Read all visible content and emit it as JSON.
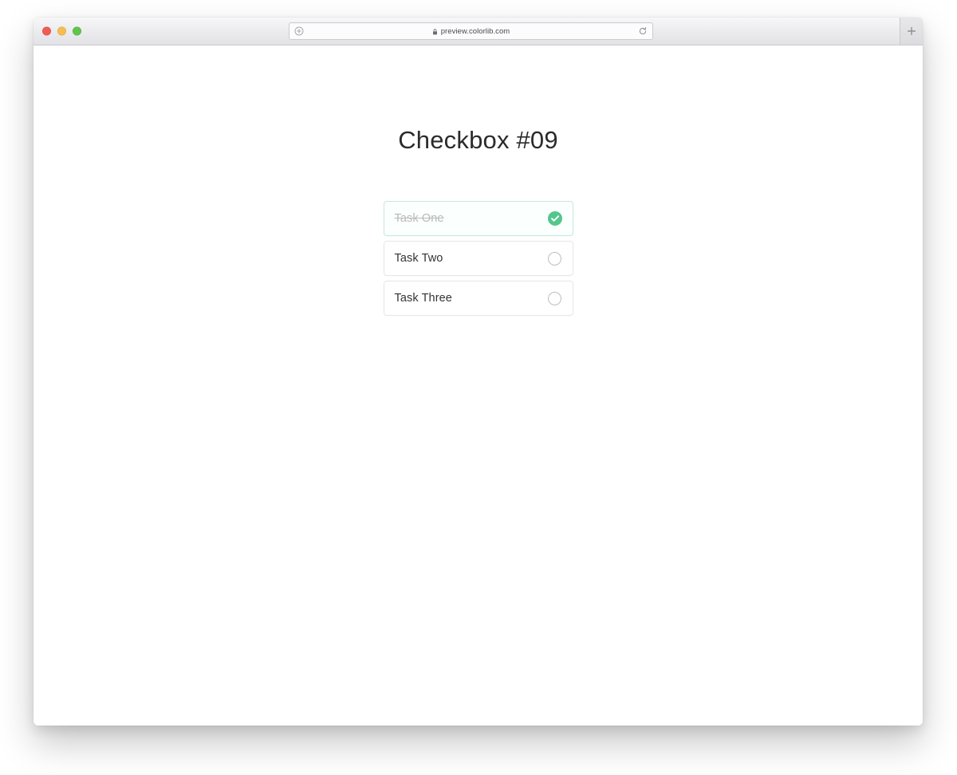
{
  "browser": {
    "traffic_lights": [
      {
        "name": "close",
        "color": "#f05b54"
      },
      {
        "name": "minimize",
        "color": "#f6bd4f"
      },
      {
        "name": "zoom",
        "color": "#60c54a"
      }
    ],
    "address_bar": {
      "url": "preview.colorlib.com",
      "secure": true,
      "left_icon": "add-bookmark-icon",
      "right_icon": "reload-icon"
    },
    "new_tab_label": "+"
  },
  "page": {
    "title": "Checkbox #09",
    "tasks": [
      {
        "label": "Task One",
        "checked": true,
        "control_icon": "check-circle-filled-icon"
      },
      {
        "label": "Task Two",
        "checked": false,
        "control_icon": "circle-outline-icon"
      },
      {
        "label": "Task Three",
        "checked": false,
        "control_icon": "circle-outline-icon"
      }
    ]
  },
  "colors": {
    "accent_green": "#53c68c",
    "checked_border": "#c7e8da",
    "checked_background": "#fbfffe",
    "item_border": "#e6e6e6",
    "text": "#333333",
    "muted_text": "#b9b9b9"
  }
}
